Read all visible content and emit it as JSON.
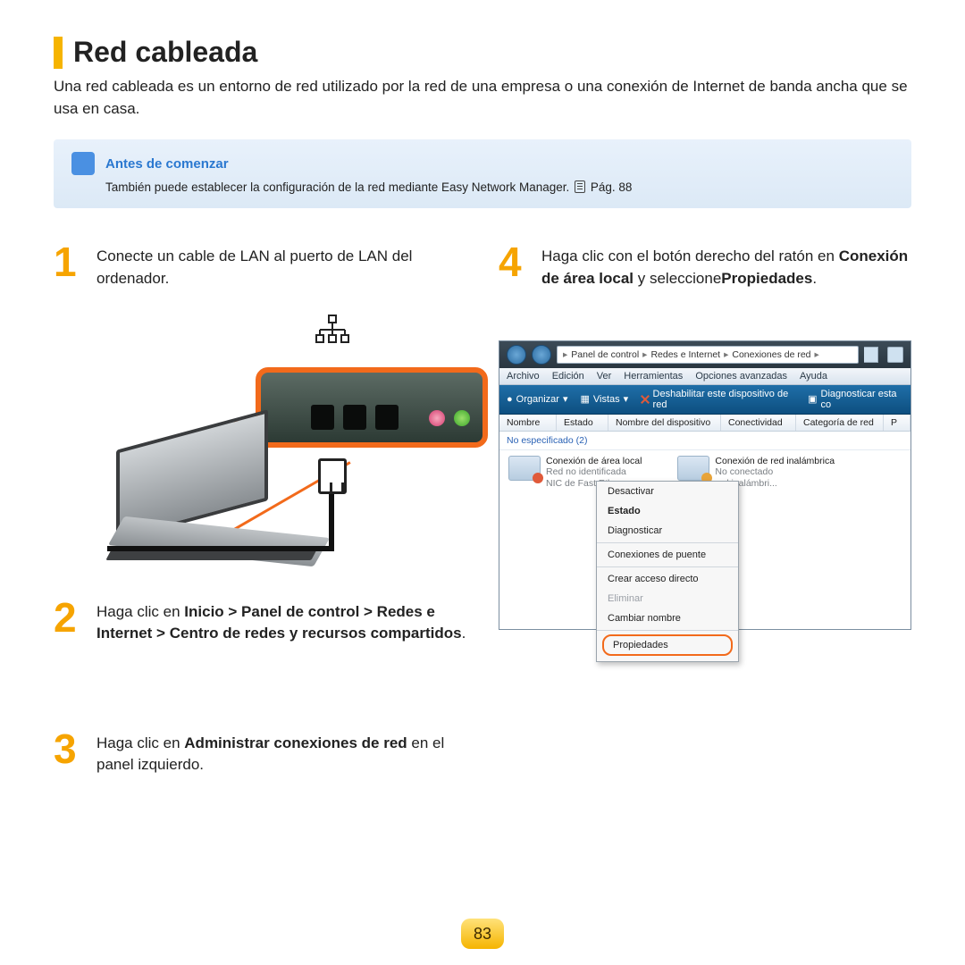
{
  "page_number": "83",
  "title": "Red cableada",
  "intro": "Una red cableada es un entorno de red utilizado por la red de una empresa o una conexión de Internet de banda ancha que se usa en casa.",
  "callout": {
    "title": "Antes de comenzar",
    "body_pre": "También puede establecer la configuración de la red mediante Easy Network Manager. ",
    "page_ref": "Pág. 88"
  },
  "steps": {
    "s1": {
      "num": "1",
      "text": "Conecte un cable de LAN al puerto de LAN del ordenador."
    },
    "s2": {
      "num": "2",
      "pre": "Haga clic en ",
      "bold": "Inicio > Panel de control > Redes e Internet > Centro de redes y recursos compartidos",
      "post": "."
    },
    "s3": {
      "num": "3",
      "pre": "Haga clic en ",
      "bold": "Administrar conexiones de red",
      "post": " en el panel izquierdo."
    },
    "s4": {
      "num": "4",
      "line1": "Haga clic con el botón derecho del ratón en",
      "bold": "Conexión de área local",
      "mid": " y seleccione",
      "bold2": "Propiedades",
      "post": "."
    }
  },
  "vista": {
    "breadcrumb": [
      "Panel de control",
      "Redes e Internet",
      "Conexiones de red"
    ],
    "menubar": [
      "Archivo",
      "Edición",
      "Ver",
      "Herramientas",
      "Opciones avanzadas",
      "Ayuda"
    ],
    "toolbar": {
      "organize": "Organizar",
      "views": "Vistas",
      "disable": "Deshabilitar este dispositivo de red",
      "diagnose": "Diagnosticar esta co"
    },
    "columns": [
      "Nombre",
      "Estado",
      "Nombre del dispositivo",
      "Conectividad",
      "Categoría de red",
      "P"
    ],
    "category": "No especificado (2)",
    "conn_local": {
      "title": "Conexión de área local",
      "sub1": "Red no identificada",
      "sub2": "NIC de Fast Ethe"
    },
    "conn_wifi": {
      "title": "Conexión de red inalámbrica",
      "sub1": "No conectado",
      "sub2": "red inalámbri..."
    },
    "context_menu": {
      "desactivar": "Desactivar",
      "estado": "Estado",
      "diagnosticar": "Diagnosticar",
      "puente": "Conexiones de puente",
      "acceso": "Crear acceso directo",
      "eliminar": "Eliminar",
      "cambiar": "Cambiar nombre",
      "propiedades": "Propiedades"
    }
  }
}
